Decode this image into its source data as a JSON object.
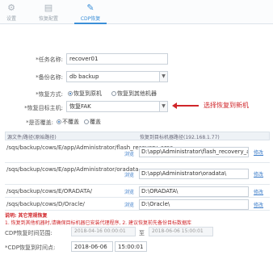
{
  "tabs": [
    {
      "label": "设置",
      "icon": "gear-icon",
      "glyph": "⚙"
    },
    {
      "label": "恢复配置",
      "icon": "document-icon",
      "glyph": "▤"
    },
    {
      "label": "CDP恢复",
      "icon": "pen-icon",
      "glyph": "✎"
    }
  ],
  "form": {
    "task_name_label": "*任务名称:",
    "task_name_value": "recover01",
    "backup_name_label": "*备份名称:",
    "backup_name_value": "db backup",
    "restore_mode_label": "*恢复方式:",
    "restore_mode_options": [
      "恢复到原机",
      "恢复到其他机器"
    ],
    "target_machine_label": "*恢复目标主机:",
    "target_machine_value": "恢复FAK",
    "overwrite_label": "*是否覆盖:",
    "overwrite_options": [
      "不覆盖",
      "覆盖"
    ]
  },
  "annotation": {
    "text": "选择恢复到新机"
  },
  "table": {
    "col_source": "源文件/路径(原始路径)",
    "col_target": "恢复到目标机器路径(192.168.1.77)",
    "rows": [
      {
        "source": "/sqs/backup/cows/E/app/Administrator/flash_recovery_area",
        "link": "浏览",
        "target": "D:\\app\\Administrator\\flash_recovery_are",
        "action": "修改"
      },
      {
        "source": "/sqs/backup/cows/E/app/Administrator/oradata",
        "link": "浏览",
        "target": "D:\\app\\Administrator\\oradata\\",
        "action": "修改"
      },
      {
        "source": "/sqs/backup/cows/E/ORADATA/",
        "link": "浏览",
        "target": "D:\\ORADATA\\",
        "action": "修改"
      },
      {
        "source": "/sqs/backup/cows/D/Oracle/",
        "link": "浏览",
        "target": "D:\\Oracle\\",
        "action": "修改"
      }
    ]
  },
  "notes": {
    "title": "说明: 其它常规恢复",
    "line1": "1. 恢复到其他机器时,请确保目标机器已安装代理程序, 2. 建议恢复前先备份目标数据库"
  },
  "cdp": {
    "range_label": "CDP恢复时间范围:",
    "range_start": "2018-04-16 00:00:01",
    "range_to": "至",
    "range_end": "2018-06-06 15:00:01",
    "point_label": "*CDP恢复到时间点:",
    "point_date": "2018-06-06",
    "point_time": "15:00:01"
  }
}
